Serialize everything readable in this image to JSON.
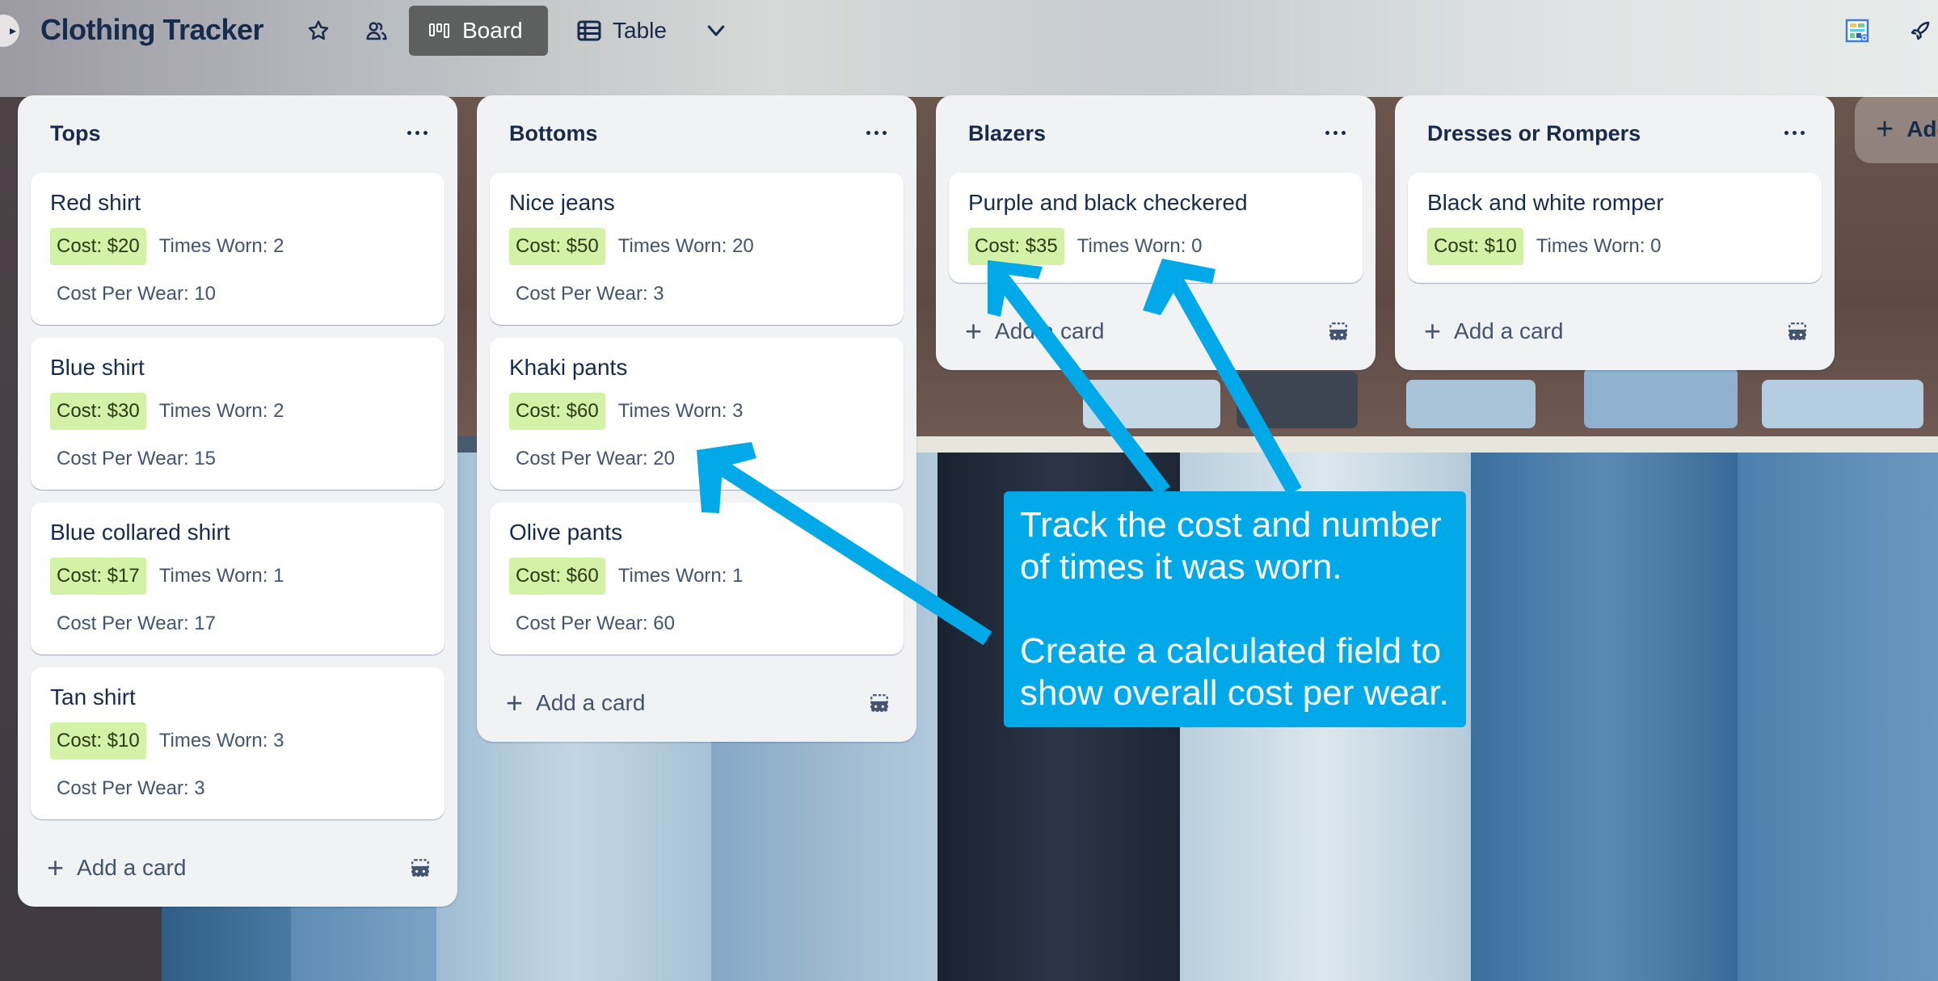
{
  "header": {
    "board_title": "Clothing Tracker",
    "views": [
      {
        "label": "Board",
        "icon": "board-icon",
        "active": true
      },
      {
        "label": "Table",
        "icon": "table-icon",
        "active": false
      }
    ],
    "icons": {
      "sidebar_toggle": "chevron-right-icon",
      "star": "star-icon",
      "visibility": "workspace-members-icon",
      "more_views": "chevron-down-icon",
      "power_up": "power-up-icon",
      "butler": "rocket-icon"
    }
  },
  "columns": [
    {
      "title": "Tops",
      "cards": [
        {
          "title": "Red shirt",
          "cost": "Cost: $20",
          "times_worn": "Times Worn: 2",
          "cost_per_wear": "Cost Per Wear: 10"
        },
        {
          "title": "Blue shirt",
          "cost": "Cost: $30",
          "times_worn": "Times Worn: 2",
          "cost_per_wear": "Cost Per Wear: 15"
        },
        {
          "title": "Blue collared shirt",
          "cost": "Cost: $17",
          "times_worn": "Times Worn: 1",
          "cost_per_wear": "Cost Per Wear: 17"
        },
        {
          "title": "Tan shirt",
          "cost": "Cost: $10",
          "times_worn": "Times Worn: 3",
          "cost_per_wear": "Cost Per Wear: 3"
        }
      ],
      "add_card_label": "Add a card"
    },
    {
      "title": "Bottoms",
      "cards": [
        {
          "title": "Nice jeans",
          "cost": "Cost: $50",
          "times_worn": "Times Worn: 20",
          "cost_per_wear": "Cost Per Wear: 3"
        },
        {
          "title": "Khaki pants",
          "cost": "Cost: $60",
          "times_worn": "Times Worn: 3",
          "cost_per_wear": "Cost Per Wear: 20"
        },
        {
          "title": "Olive pants",
          "cost": "Cost: $60",
          "times_worn": "Times Worn: 1",
          "cost_per_wear": "Cost Per Wear: 60"
        }
      ],
      "add_card_label": "Add a card"
    },
    {
      "title": "Blazers",
      "cards": [
        {
          "title": "Purple and black checkered",
          "cost": "Cost: $35",
          "times_worn": "Times Worn: 0",
          "cost_per_wear": null
        }
      ],
      "add_card_label": "Add a card"
    },
    {
      "title": "Dresses or Rompers",
      "cards": [
        {
          "title": "Black and white romper",
          "cost": "Cost: $10",
          "times_worn": "Times Worn: 0",
          "cost_per_wear": null
        }
      ],
      "add_card_label": "Add a card"
    }
  ],
  "add_list_label": "Add another list",
  "annotation": {
    "line1": "Track the cost and number of times it was worn.",
    "line2": "Create a calculated field to show overall cost per wear.",
    "color": "#02a9e9"
  },
  "colors": {
    "cost_badge_bg": "#d3f1a7",
    "text_primary": "#172b4d",
    "text_secondary": "#44546f",
    "list_bg": "#f1f2f4",
    "active_view_bg": "#5e5f5f"
  }
}
